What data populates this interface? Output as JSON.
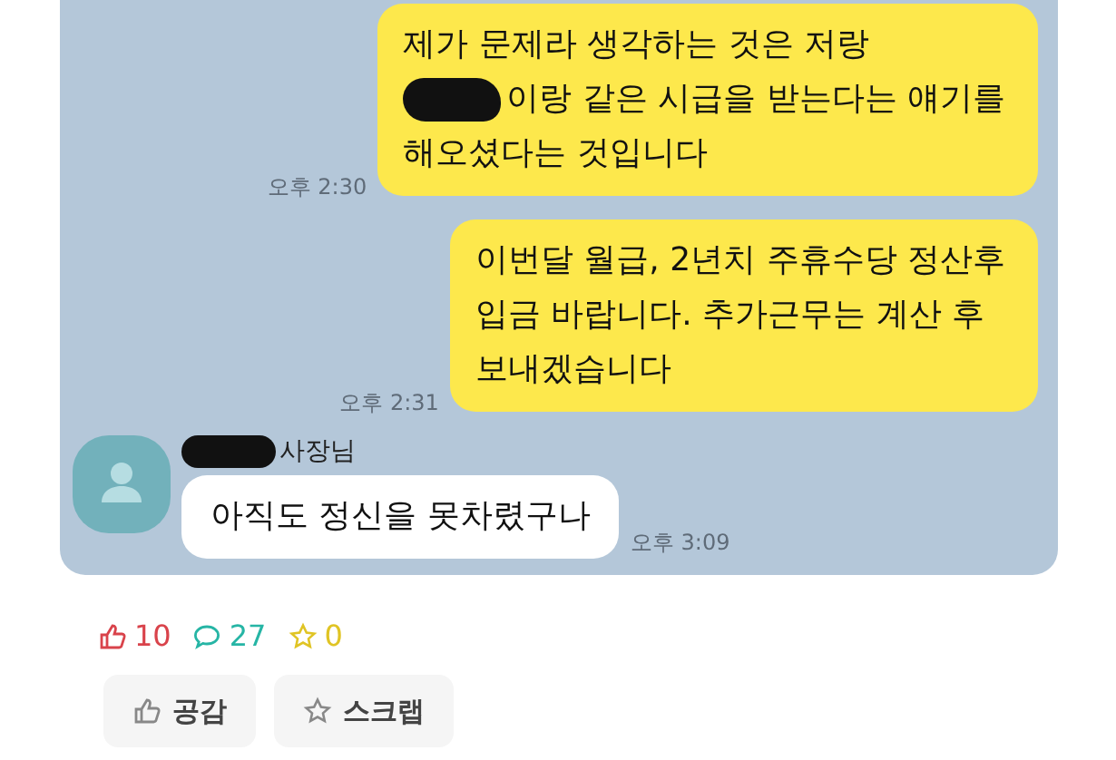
{
  "chat": {
    "messages": [
      {
        "kind": "mine",
        "time": "오후 2:30",
        "lines": [
          {
            "text": "제가 문제라 생각하는 것은 저랑",
            "redacted": false
          },
          {
            "text": "이랑 같은 시급을 받는다는 얘기를",
            "redacted": true
          },
          {
            "text": "해오셨다는 것입니다",
            "redacted": false
          }
        ]
      },
      {
        "kind": "mine",
        "time": "오후 2:31",
        "lines": [
          {
            "text": "이번달 월급, 2년치 주휴수당 정산후",
            "redacted": false
          },
          {
            "text": "입금 바랍니다. 추가근무는 계산 후",
            "redacted": false
          },
          {
            "text": "보내겠습니다",
            "redacted": false
          }
        ]
      },
      {
        "kind": "received",
        "sender": "사장님",
        "sender_redacted": true,
        "time": "오후 3:09",
        "lines": [
          {
            "text": "아직도 정신을 못차렸구나",
            "redacted": false
          }
        ]
      }
    ]
  },
  "stats": [
    {
      "kind": "like",
      "count": "10",
      "color": "#d9434b"
    },
    {
      "kind": "comment",
      "count": "27",
      "color": "#26b5a5"
    },
    {
      "kind": "star",
      "count": "0",
      "color": "#e0c424"
    }
  ],
  "actions": [
    {
      "kind": "like",
      "label": "공감"
    },
    {
      "kind": "star",
      "label": "스크랩"
    }
  ]
}
